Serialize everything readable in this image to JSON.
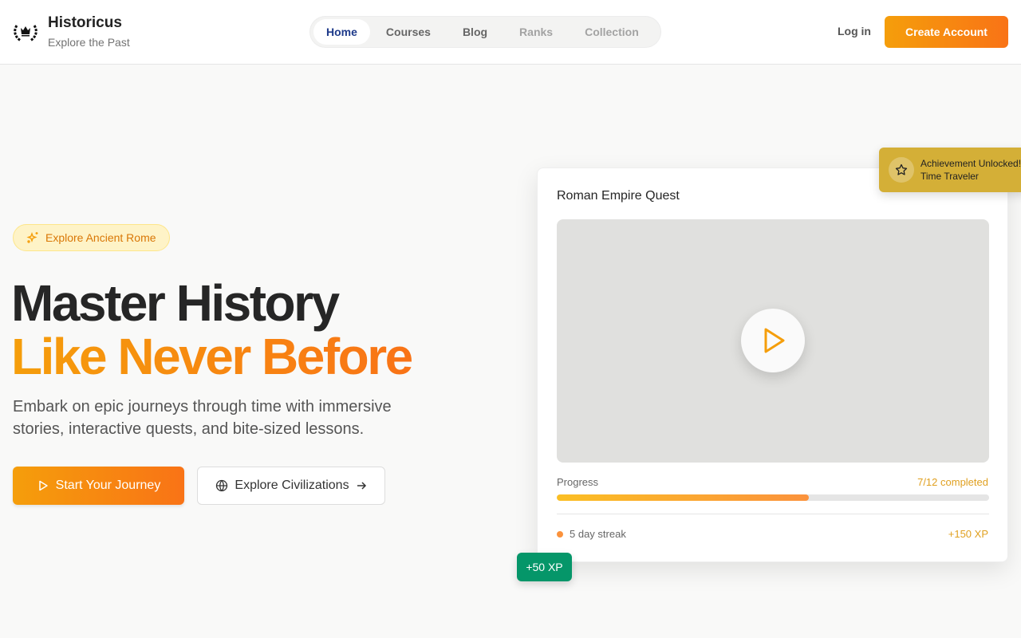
{
  "header": {
    "brand": "Historicus",
    "tagline": "Explore the Past",
    "nav": [
      {
        "label": "Home"
      },
      {
        "label": "Courses"
      },
      {
        "label": "Blog"
      },
      {
        "label": "Ranks"
      },
      {
        "label": "Collection"
      }
    ],
    "login": "Log in",
    "create_account": "Create Account"
  },
  "hero": {
    "pill": "Explore Ancient Rome",
    "title_line1": "Master History",
    "title_line2": "Like Never Before",
    "description": "Embark on epic journeys through time with immersive stories, interactive quests, and bite-sized lessons.",
    "primary_button": "Start Your Journey",
    "secondary_button": "Explore Civilizations"
  },
  "card": {
    "title": "Roman Empire Quest",
    "progress_label": "Progress",
    "progress_text": "7/12 completed",
    "progress_fraction": 0.583,
    "streak": "5 day streak",
    "xp": "+150 XP"
  },
  "achievement": {
    "title": "Achievement Unlocked!",
    "name": "Time Traveler"
  },
  "xp_badge": "+50 XP",
  "colors": {
    "accent": "#f59e0b",
    "accent2": "#f97316",
    "nav_active": "#1e3a8a",
    "gold": "#d4af37",
    "green": "#059669"
  }
}
